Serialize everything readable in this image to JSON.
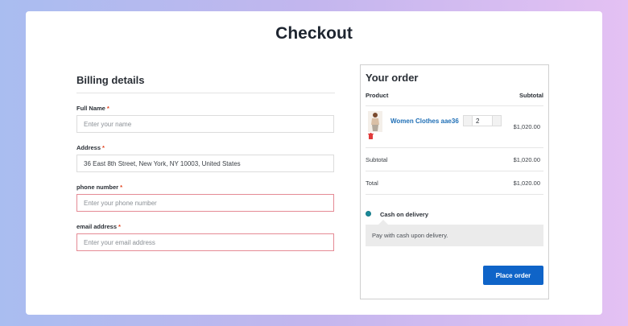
{
  "page": {
    "title": "Checkout"
  },
  "billing": {
    "title": "Billing details",
    "required_mark": "*",
    "fields": [
      {
        "label": "Full Name",
        "value": "",
        "placeholder": "Enter your name"
      },
      {
        "label": "Address",
        "value": "36 East 8th Street, New York, NY 10003, United States",
        "placeholder": ""
      },
      {
        "label": "phone number",
        "value": "",
        "placeholder": "Enter your phone number"
      },
      {
        "label": "email address",
        "value": "",
        "placeholder": "Enter your email address"
      }
    ]
  },
  "order": {
    "title": "Your order",
    "col_product": "Product",
    "col_subtotal": "Subtotal",
    "item": {
      "name": "Women Clothes aae36",
      "quantity": "2",
      "total": "$1,020.00"
    },
    "subtotal_label": "Subtotal",
    "subtotal_value": "$1,020.00",
    "total_label": "Total",
    "total_value": "$1,020.00",
    "payment": {
      "method": "Cash on delivery",
      "description": "Pay with cash upon delivery."
    },
    "place_order_label": "Place order"
  },
  "colors": {
    "accent": "#0f64c8",
    "link": "#1f6fb6",
    "required": "#e2401c",
    "radio": "#1b8a9a",
    "error_border": "#e58a95"
  }
}
